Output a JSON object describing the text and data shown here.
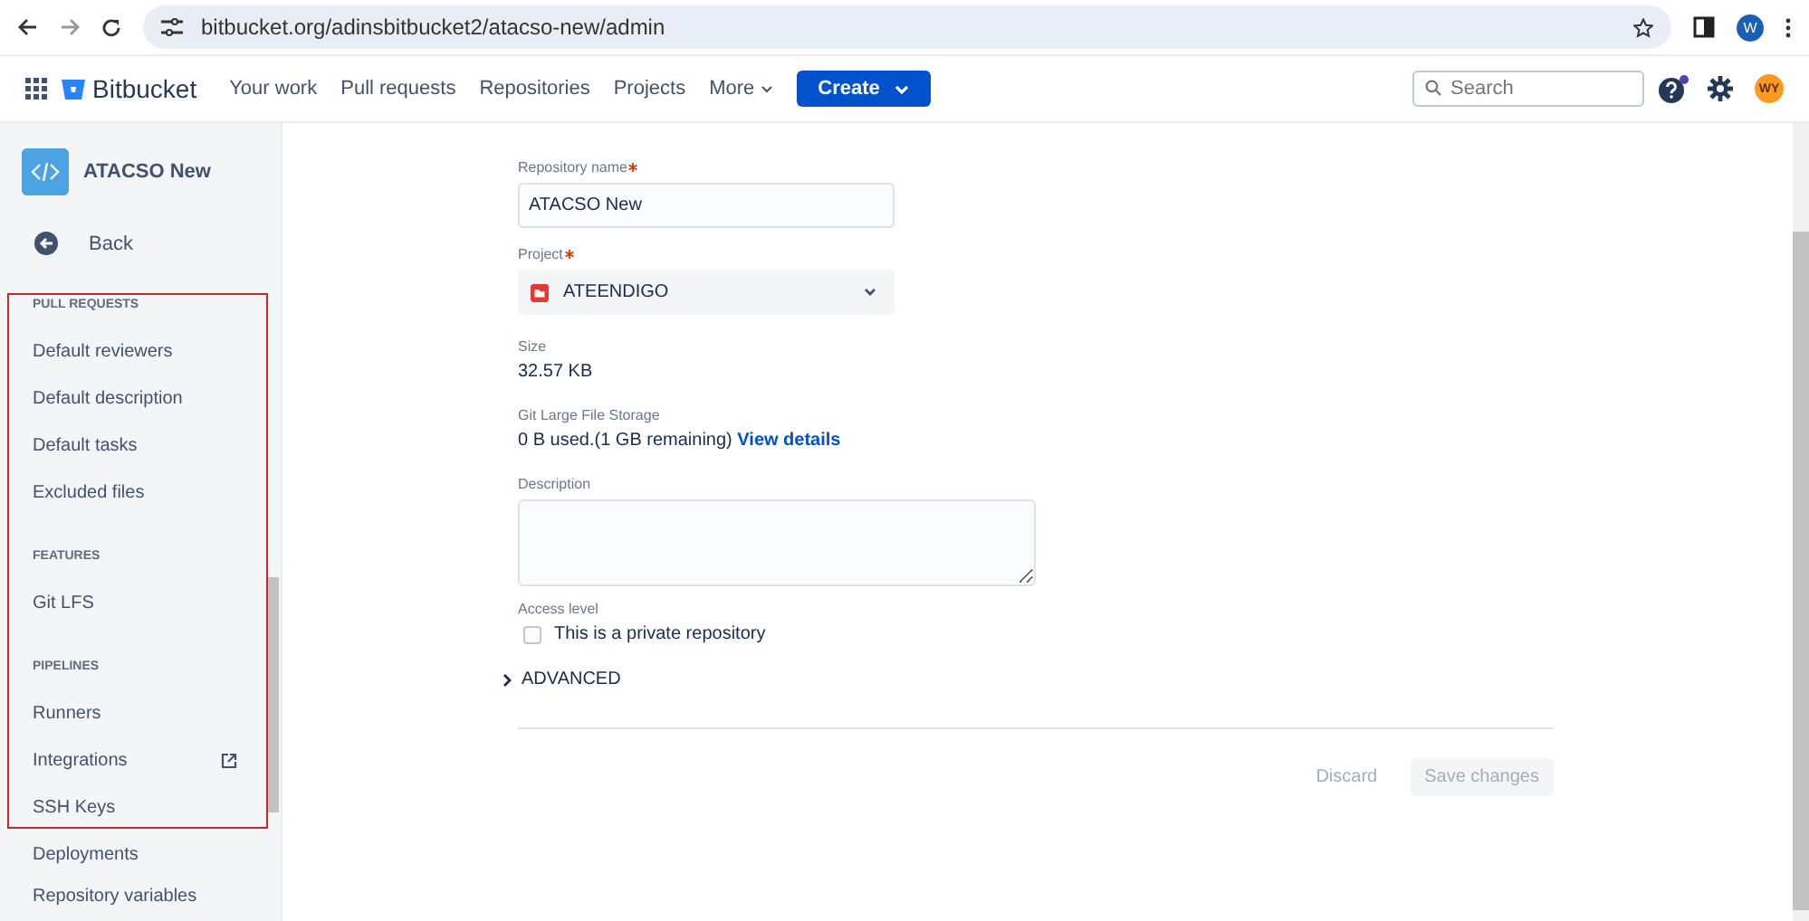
{
  "browser": {
    "url": "bitbucket.org/adinsbitbucket2/atacso-new/admin",
    "profile": "W"
  },
  "header": {
    "logo": "Bitbucket",
    "nav": [
      {
        "label": "Your work",
        "dropdown": false
      },
      {
        "label": "Pull requests",
        "dropdown": false
      },
      {
        "label": "Repositories",
        "dropdown": false
      },
      {
        "label": "Projects",
        "dropdown": false
      },
      {
        "label": "More",
        "dropdown": true
      }
    ],
    "create": "Create",
    "search": {
      "placeholder": "Search"
    },
    "avatar": "WY"
  },
  "sidebar": {
    "repo": "ATACSO New",
    "back": "Back",
    "items": [
      {
        "kind": "heading",
        "label": "PULL REQUESTS"
      },
      {
        "kind": "link",
        "label": "Default reviewers"
      },
      {
        "kind": "link",
        "label": "Default description"
      },
      {
        "kind": "link",
        "label": "Default tasks"
      },
      {
        "kind": "link",
        "label": "Excluded files"
      },
      {
        "kind": "heading",
        "label": "FEATURES"
      },
      {
        "kind": "link",
        "label": "Git LFS"
      },
      {
        "kind": "heading",
        "label": "PIPELINES"
      },
      {
        "kind": "link",
        "label": "Runners"
      },
      {
        "kind": "external",
        "label": "Integrations"
      },
      {
        "kind": "link",
        "label": "SSH Keys"
      },
      {
        "kind": "link",
        "label": "Deployments"
      },
      {
        "kind": "link",
        "label": "Repository variables"
      }
    ]
  },
  "form": {
    "repo_name": {
      "label": "Repository name",
      "required": true,
      "value": "ATACSO New"
    },
    "project": {
      "label": "Project",
      "required": true,
      "value": "ATEENDIGO"
    },
    "size": {
      "label": "Size",
      "value": "32.57 KB"
    },
    "lfs": {
      "label": "Git Large File Storage",
      "value": "0 B used.(1 GB remaining)",
      "link": "View details"
    },
    "description": {
      "label": "Description"
    },
    "access": {
      "label": "Access level",
      "checkbox": "This is a private repository",
      "checked": false
    },
    "advanced": {
      "label": "ADVANCED",
      "expanded": false
    },
    "buttons": [
      {
        "label": "Discard",
        "kind": "subtle",
        "disabled": true
      },
      {
        "label": "Save changes",
        "kind": "primary",
        "disabled": true
      }
    ]
  }
}
